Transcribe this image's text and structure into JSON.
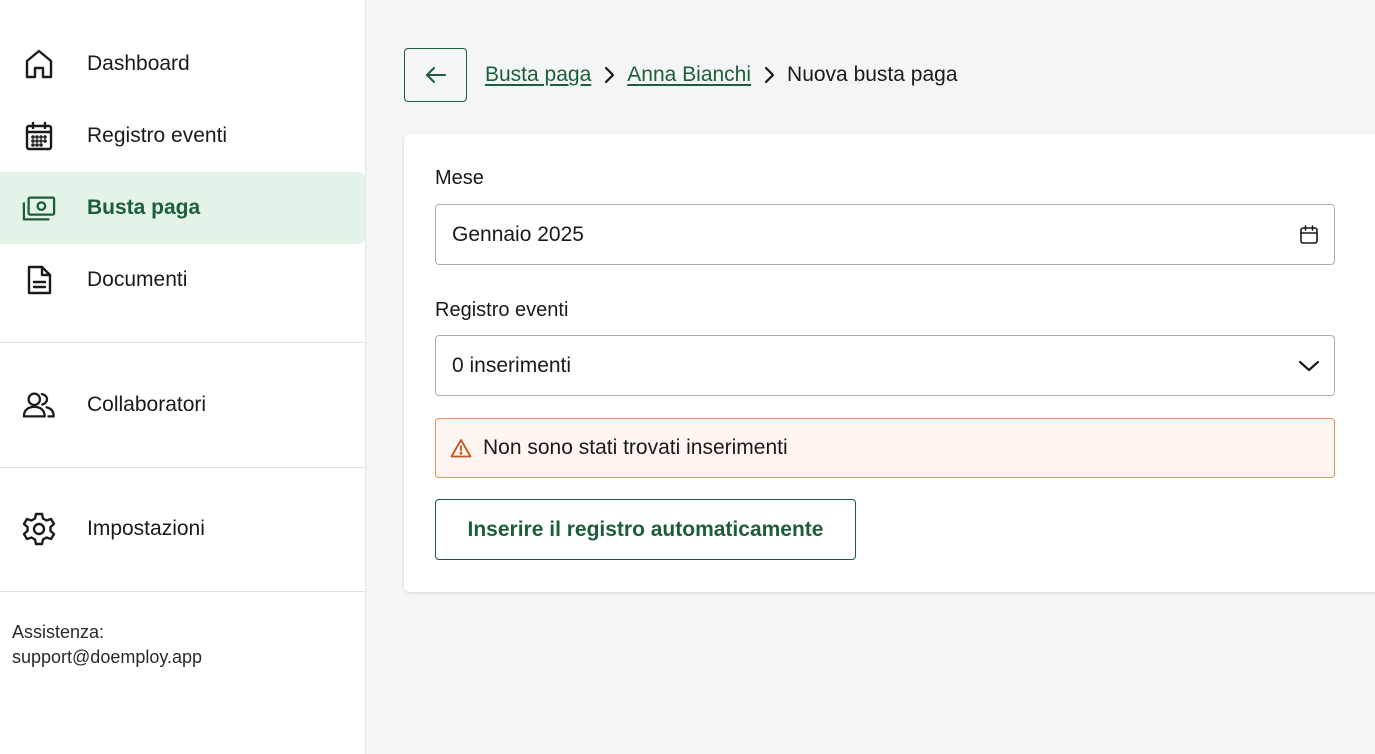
{
  "sidebar": {
    "items": [
      {
        "label": "Dashboard",
        "icon": "home-icon"
      },
      {
        "label": "Registro eventi",
        "icon": "calendar-icon"
      },
      {
        "label": "Busta paga",
        "icon": "money-icon",
        "active": true
      },
      {
        "label": "Documenti",
        "icon": "document-icon"
      },
      {
        "label": "Collaboratori",
        "icon": "users-icon"
      },
      {
        "label": "Impostazioni",
        "icon": "gear-icon"
      }
    ],
    "support_label": "Assistenza:",
    "support_email": "support@doemploy.app"
  },
  "header": {
    "back_icon": "arrow-left-icon",
    "breadcrumb": [
      "Busta paga",
      "Anna Bianchi",
      "Nuova busta paga"
    ]
  },
  "form": {
    "month_label": "Mese",
    "month_value": "Gennaio 2025",
    "events_label": "Registro eventi",
    "events_value": "0 inserimenti",
    "warning_text": "Non sono stati trovati inserimenti",
    "action_label": "Inserire il registro automaticamente"
  },
  "colors": {
    "accent": "#1d5e3a",
    "active_bg": "#e3f3e8",
    "warning_border": "#e6925f",
    "warning_bg": "#fef5f1",
    "warning_icon": "#c2541c"
  }
}
